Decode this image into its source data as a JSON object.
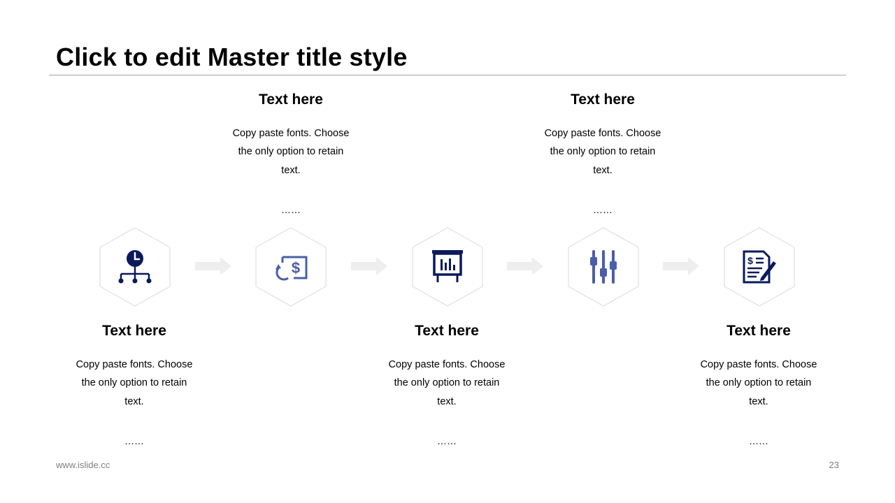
{
  "slide": {
    "title": "Click to edit Master title style",
    "footer_url": "www.islide.cc",
    "page_number": "23"
  },
  "colors": {
    "icon_dark": "#0a1a5c",
    "icon_light": "#4a5fa8",
    "hex_border": "#d9d9d9",
    "arrow": "#eeeeee"
  },
  "steps": [
    {
      "heading": "Text here",
      "body": "Copy paste fonts. Choose the only option to retain text.",
      "dots": "……",
      "icon": "clock-network-icon"
    },
    {
      "heading": "Text here",
      "body": "Copy paste fonts. Choose the only option to retain text.",
      "dots": "……",
      "icon": "dollar-cycle-icon"
    },
    {
      "heading": "Text here",
      "body": "Copy paste fonts. Choose the only option to retain text.",
      "dots": "……",
      "icon": "presentation-chart-icon"
    },
    {
      "heading": "Text here",
      "body": "Copy paste fonts. Choose the only option to retain text.",
      "dots": "……",
      "icon": "sliders-icon"
    },
    {
      "heading": "Text here",
      "body": "Copy paste fonts. Choose the only option to retain text.",
      "dots": "……",
      "icon": "invoice-signature-icon"
    }
  ]
}
